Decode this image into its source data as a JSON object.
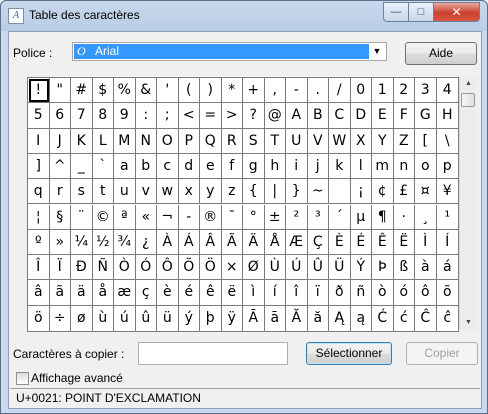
{
  "window": {
    "title": "Table des caractères",
    "controls": {
      "minimize": "—",
      "maximize": "□",
      "close": "✕"
    }
  },
  "font": {
    "label": "Police :",
    "selected": "Arial"
  },
  "help_label": "Aide",
  "grid": {
    "selected": "!",
    "rows": [
      [
        "!",
        "\"",
        "#",
        "$",
        "%",
        "&",
        "'",
        "(",
        ")",
        "*",
        "+",
        ",",
        "-",
        ".",
        "/",
        "0",
        "1",
        "2",
        "3",
        "4"
      ],
      [
        "5",
        "6",
        "7",
        "8",
        "9",
        ":",
        ";",
        "<",
        "=",
        ">",
        "?",
        "@",
        "A",
        "B",
        "C",
        "D",
        "E",
        "F",
        "G",
        "H"
      ],
      [
        "I",
        "J",
        "K",
        "L",
        "M",
        "N",
        "O",
        "P",
        "Q",
        "R",
        "S",
        "T",
        "U",
        "V",
        "W",
        "X",
        "Y",
        "Z",
        "[",
        "\\"
      ],
      [
        "]",
        "^",
        "_",
        "`",
        "a",
        "b",
        "c",
        "d",
        "e",
        "f",
        "g",
        "h",
        "i",
        "j",
        "k",
        "l",
        "m",
        "n",
        "o",
        "p"
      ],
      [
        "q",
        "r",
        "s",
        "t",
        "u",
        "v",
        "w",
        "x",
        "y",
        "z",
        "{",
        "|",
        "}",
        "~",
        " ",
        "¡",
        "¢",
        "£",
        "¤",
        "¥"
      ],
      [
        "¦",
        "§",
        "¨",
        "©",
        "ª",
        "«",
        "¬",
        "-",
        "®",
        "¯",
        "°",
        "±",
        "²",
        "³",
        "´",
        "µ",
        "¶",
        "·",
        "¸",
        "¹"
      ],
      [
        "º",
        "»",
        "¼",
        "½",
        "¾",
        "¿",
        "À",
        "Á",
        "Â",
        "Ã",
        "Ä",
        "Å",
        "Æ",
        "Ç",
        "È",
        "É",
        "Ê",
        "Ë",
        "Ì",
        "Í"
      ],
      [
        "Î",
        "Ï",
        "Ð",
        "Ñ",
        "Ò",
        "Ó",
        "Ô",
        "Õ",
        "Ö",
        "×",
        "Ø",
        "Ù",
        "Ú",
        "Û",
        "Ü",
        "Ý",
        "Þ",
        "ß",
        "à",
        "á"
      ],
      [
        "â",
        "ã",
        "ä",
        "å",
        "æ",
        "ç",
        "è",
        "é",
        "ê",
        "ë",
        "ì",
        "í",
        "î",
        "ï",
        "ð",
        "ñ",
        "ò",
        "ó",
        "ô",
        "õ"
      ],
      [
        "ö",
        "÷",
        "ø",
        "ù",
        "ú",
        "û",
        "ü",
        "ý",
        "þ",
        "ÿ",
        "Ā",
        "ā",
        "Ă",
        "ă",
        "Ą",
        "ą",
        "Ć",
        "ć",
        "Ĉ",
        "ĉ"
      ]
    ]
  },
  "copy": {
    "label": "Caractères à copier :",
    "value": "",
    "select_label": "Sélectionner",
    "copy_label": "Copier"
  },
  "advanced_view": {
    "label": "Affichage avancé",
    "checked": false
  },
  "status": "U+0021: POINT D'EXCLAMATION"
}
